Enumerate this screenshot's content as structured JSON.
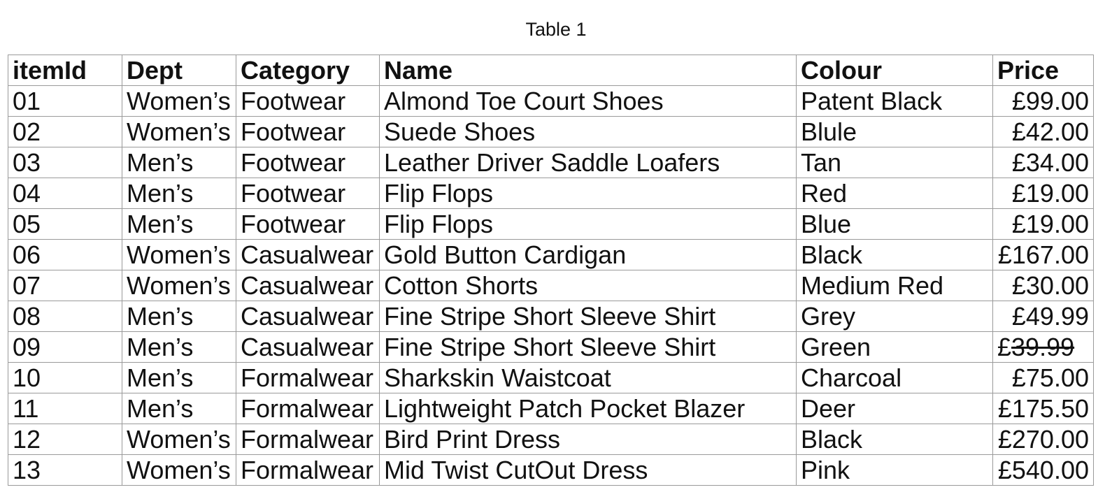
{
  "caption": "Table 1",
  "columns": [
    "itemId",
    "Dept",
    "Category",
    "Name",
    "Colour",
    "Price"
  ],
  "rows": [
    {
      "id": "01",
      "dept": "Women’s",
      "category": "Footwear",
      "name": "Almond Toe Court Shoes",
      "colour": "Patent Black",
      "price": "£99.00"
    },
    {
      "id": "02",
      "dept": "Women’s",
      "category": "Footwear",
      "name": "Suede Shoes",
      "colour": "Blule",
      "price": "£42.00"
    },
    {
      "id": "03",
      "dept": "Men’s",
      "category": "Footwear",
      "name": "Leather Driver Saddle Loafers",
      "colour": "Tan",
      "price": "£34.00"
    },
    {
      "id": "04",
      "dept": "Men’s",
      "category": "Footwear",
      "name": "Flip Flops",
      "colour": "Red",
      "price": "£19.00"
    },
    {
      "id": "05",
      "dept": "Men’s",
      "category": "Footwear",
      "name": "Flip Flops",
      "colour": "Blue",
      "price": "£19.00"
    },
    {
      "id": "06",
      "dept": "Women’s",
      "category": "Casualwear",
      "name": "Gold Button Cardigan",
      "colour": "Black",
      "price": "£167.00"
    },
    {
      "id": "07",
      "dept": "Women’s",
      "category": "Casualwear",
      "name": "Cotton Shorts",
      "colour": "Medium Red",
      "price": "£30.00"
    },
    {
      "id": "08",
      "dept": "Men’s",
      "category": "Casualwear",
      "name": "Fine Stripe Short Sleeve Shirt",
      "colour": "Grey",
      "price": "£49.99"
    },
    {
      "id": "09",
      "dept": "Men’s",
      "category": "Casualwear",
      "name": "Fine Stripe Short Sleeve Shirt",
      "colour": "Green",
      "price_prefix": "£",
      "price_struck": "39.99"
    },
    {
      "id": "10",
      "dept": "Men’s",
      "category": "Formalwear",
      "name": "Sharkskin Waistcoat",
      "colour": "Charcoal",
      "price": "£75.00"
    },
    {
      "id": "11",
      "dept": "Men’s",
      "category": "Formalwear",
      "name": "Lightweight Patch Pocket Blazer",
      "colour": "Deer",
      "price": "£175.50"
    },
    {
      "id": "12",
      "dept": "Women’s",
      "category": "Formalwear",
      "name": "Bird Print Dress",
      "colour": "Black",
      "price": "£270.00"
    },
    {
      "id": "13",
      "dept": "Women’s",
      "category": "Formalwear",
      "name": "Mid Twist CutOut Dress",
      "colour": "Pink",
      "price": "£540.00"
    }
  ]
}
